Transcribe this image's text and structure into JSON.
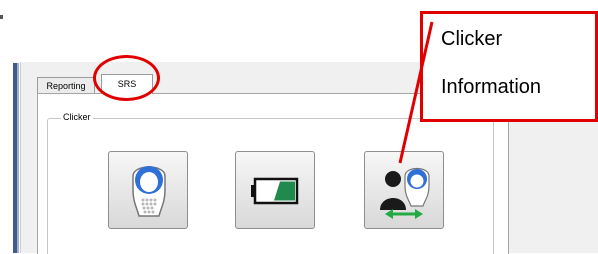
{
  "tabs": [
    {
      "label": "Reporting"
    },
    {
      "label": "SRS"
    }
  ],
  "group": {
    "label": "Clicker"
  },
  "buttons": [
    {
      "icon": "clicker-remote-icon"
    },
    {
      "icon": "battery-icon"
    },
    {
      "icon": "clicker-information-icon"
    }
  ],
  "annotation": {
    "line1": "Clicker",
    "line2": "Information"
  },
  "colors": {
    "annotation": "#e00000",
    "battery_fill": "#1f8a4c",
    "clicker_blue": "#2f6fd8",
    "arrow_green": "#22aa44"
  }
}
